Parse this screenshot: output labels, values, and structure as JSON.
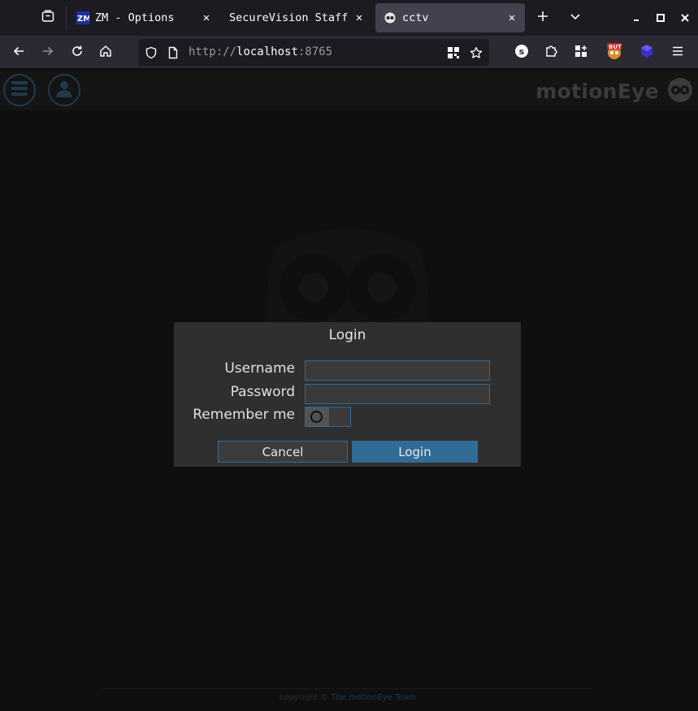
{
  "browser": {
    "tabs": [
      {
        "title": "ZM - Options",
        "favicon": "zm-logo-icon",
        "active": false
      },
      {
        "title": "SecureVision Staff",
        "favicon": "",
        "active": false
      },
      {
        "title": "cctv",
        "favicon": "owl-icon",
        "active": true
      }
    ],
    "url_scheme": "http://",
    "url_host": "localhost",
    "url_port": ":8765",
    "extension_badge_text": "BUT"
  },
  "page": {
    "brand": "motionEye",
    "footer_prefix": "copyright © ",
    "footer_link": "The motionEye Team"
  },
  "login_dialog": {
    "title": "Login",
    "username_label": "Username",
    "password_label": "Password",
    "remember_label": "Remember me",
    "username_value": "",
    "password_value": "",
    "remember_checked": false,
    "cancel_label": "Cancel",
    "login_label": "Login"
  },
  "colors": {
    "accent": "#316b96",
    "dialog_bg": "#2f2f2f",
    "page_bg": "#0f0f0f"
  }
}
